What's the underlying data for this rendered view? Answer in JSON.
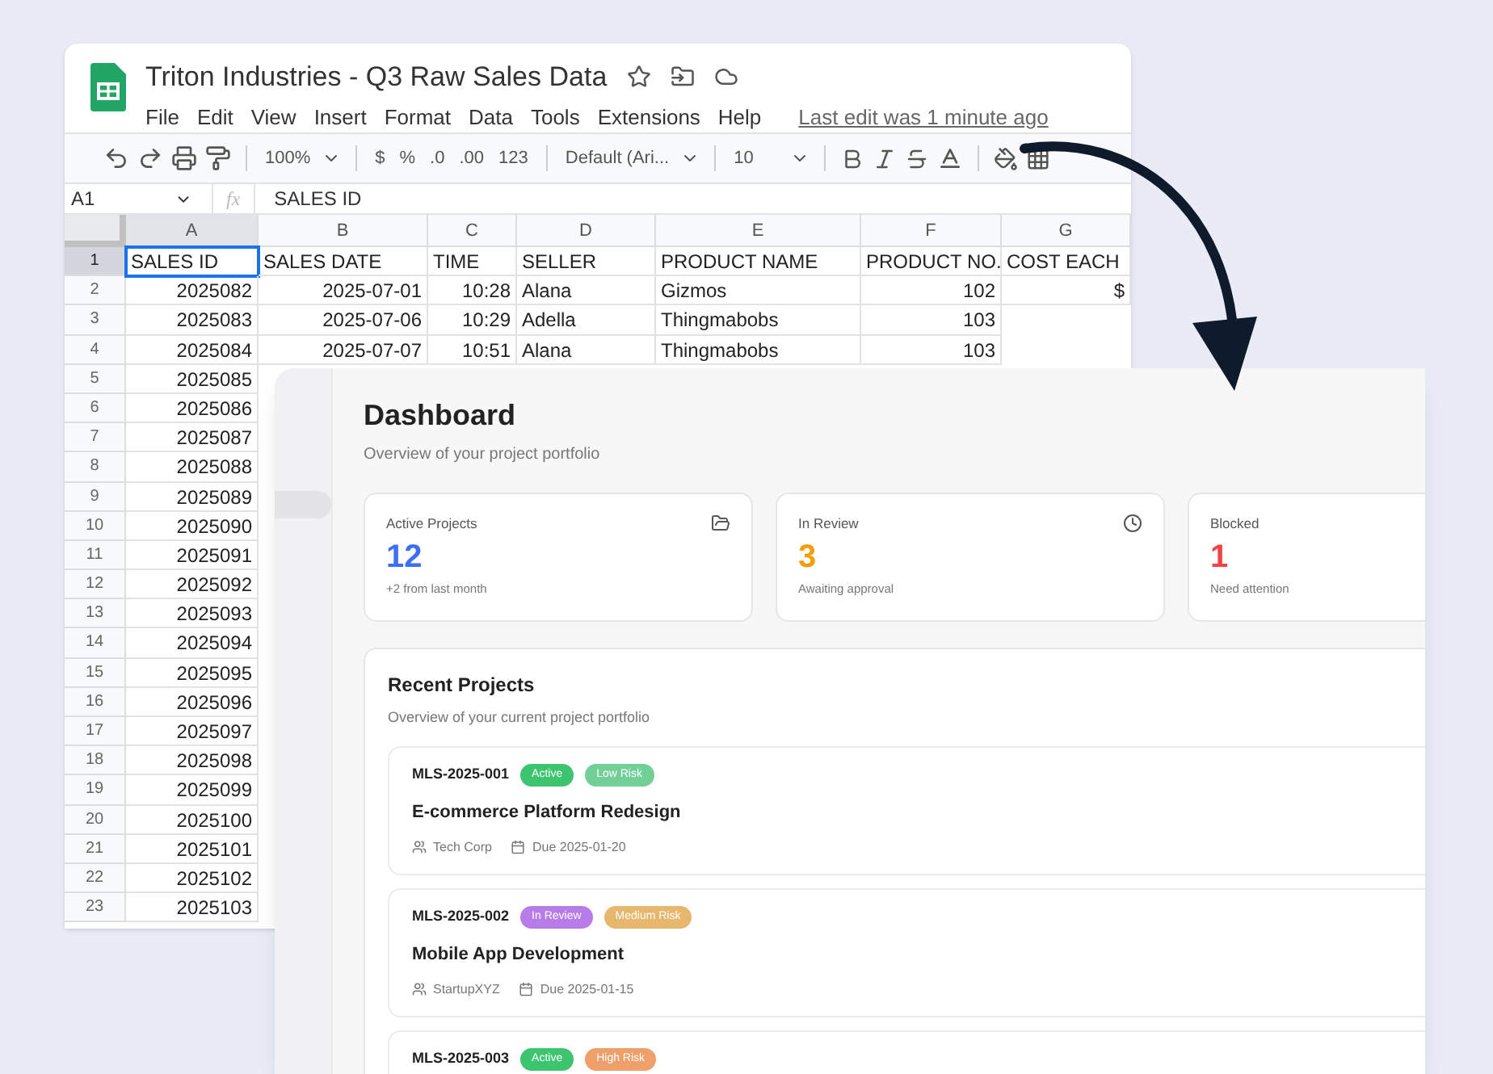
{
  "sheet": {
    "title": "Triton Industries - Q3 Raw Sales Data",
    "menus": [
      "File",
      "Edit",
      "View",
      "Insert",
      "Format",
      "Data",
      "Tools",
      "Extensions",
      "Help"
    ],
    "last_edit": "Last edit was 1 minute ago",
    "toolbar": {
      "zoom": "100%",
      "currency": "$",
      "percent": "%",
      "decrease_decimal": ".0",
      "increase_decimal": ".00",
      "number_format": "123",
      "font": "Default (Ari...",
      "font_size": "10"
    },
    "name_box": "A1",
    "fx": "fx",
    "formula": "SALES ID",
    "columns": [
      {
        "label": "A",
        "selected": true
      },
      {
        "label": "B",
        "selected": false
      },
      {
        "label": "C",
        "selected": false
      },
      {
        "label": "D",
        "selected": false
      },
      {
        "label": "E",
        "selected": false
      },
      {
        "label": "F",
        "selected": false
      },
      {
        "label": "G",
        "selected": false
      }
    ],
    "rows": [
      {
        "num": "1",
        "selected": true,
        "cells": [
          "SALES ID",
          "SALES DATE",
          "TIME",
          "SELLER",
          "PRODUCT NAME",
          "PRODUCT NO.",
          "COST EACH"
        ]
      },
      {
        "num": "2",
        "selected": false,
        "cells": [
          "2025082",
          "2025-07-01",
          "10:28",
          "Alana",
          "Gizmos",
          "102",
          "$"
        ]
      },
      {
        "num": "3",
        "selected": false,
        "cells": [
          "2025083",
          "2025-07-06",
          "10:29",
          "Adella",
          "Thingmabobs",
          "103"
        ]
      },
      {
        "num": "4",
        "selected": false,
        "cells": [
          "2025084",
          "2025-07-07",
          "10:51",
          "Alana",
          "Thingmabobs",
          "103"
        ]
      },
      {
        "num": "5",
        "selected": false,
        "cells": [
          "2025085"
        ]
      },
      {
        "num": "6",
        "selected": false,
        "cells": [
          "2025086"
        ]
      },
      {
        "num": "7",
        "selected": false,
        "cells": [
          "2025087"
        ]
      },
      {
        "num": "8",
        "selected": false,
        "cells": [
          "2025088"
        ]
      },
      {
        "num": "9",
        "selected": false,
        "cells": [
          "2025089"
        ]
      },
      {
        "num": "10",
        "selected": false,
        "cells": [
          "2025090"
        ]
      },
      {
        "num": "11",
        "selected": false,
        "cells": [
          "2025091"
        ]
      },
      {
        "num": "12",
        "selected": false,
        "cells": [
          "2025092"
        ]
      },
      {
        "num": "13",
        "selected": false,
        "cells": [
          "2025093"
        ]
      },
      {
        "num": "14",
        "selected": false,
        "cells": [
          "2025094"
        ]
      },
      {
        "num": "15",
        "selected": false,
        "cells": [
          "2025095"
        ]
      },
      {
        "num": "16",
        "selected": false,
        "cells": [
          "2025096"
        ]
      },
      {
        "num": "17",
        "selected": false,
        "cells": [
          "2025097"
        ]
      },
      {
        "num": "18",
        "selected": false,
        "cells": [
          "2025098"
        ]
      },
      {
        "num": "19",
        "selected": false,
        "cells": [
          "2025099"
        ]
      },
      {
        "num": "20",
        "selected": false,
        "cells": [
          "2025100"
        ]
      },
      {
        "num": "21",
        "selected": false,
        "cells": [
          "2025101"
        ]
      },
      {
        "num": "22",
        "selected": false,
        "cells": [
          "2025102"
        ]
      },
      {
        "num": "23",
        "selected": false,
        "cells": [
          "2025103"
        ]
      }
    ]
  },
  "dashboard": {
    "sidebar": {
      "items": [
        {
          "selected": true
        }
      ]
    },
    "title": "Dashboard",
    "subtitle": "Overview of your project portfolio",
    "stats": [
      {
        "label": "Active Projects",
        "value": "12",
        "note": "+2 from last month",
        "color": "#3b6ff5"
      },
      {
        "label": "In Review",
        "value": "3",
        "note": "Awaiting approval",
        "color": "#f59e0b"
      },
      {
        "label": "Blocked",
        "value": "1",
        "note": "Need attention",
        "color": "#ef4444"
      }
    ],
    "recent": {
      "title": "Recent Projects",
      "subtitle": "Overview of your current project portfolio",
      "projects": [
        {
          "id": "MLS-2025-001",
          "badges": [
            {
              "text": "Active",
              "color": "#3cc56e"
            },
            {
              "text": "Low Risk",
              "color": "#72cf98"
            }
          ],
          "name": "E-commerce Platform Redesign",
          "client": "Tech Corp",
          "due": "Due 2025-01-20"
        },
        {
          "id": "MLS-2025-002",
          "badges": [
            {
              "text": "In Review",
              "color": "#b77ce9"
            },
            {
              "text": "Medium Risk",
              "color": "#e6b76c"
            }
          ],
          "name": "Mobile App Development",
          "client": "StartupXYZ",
          "due": "Due 2025-01-15"
        },
        {
          "id": "MLS-2025-003",
          "badges": [
            {
              "text": "Active",
              "color": "#3cc56e"
            },
            {
              "text": "High Risk",
              "color": "#ee9f6a"
            }
          ]
        }
      ]
    }
  }
}
